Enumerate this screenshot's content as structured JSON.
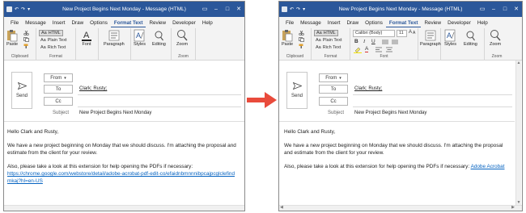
{
  "windows": {
    "left": {
      "title": "New Project Begins Next Monday  -  Message (HTML)",
      "menu": [
        "File",
        "Message",
        "Insert",
        "Draw",
        "Options",
        "Format Text",
        "Review",
        "Developer",
        "Help"
      ],
      "active_tab": "Format Text",
      "ribbon": {
        "paste": "Paste",
        "html": "HTML",
        "plain_text": "Plain Text",
        "rich_text": "Rich Text",
        "font": "Font",
        "paragraph": "Paragraph",
        "styles": "Styles",
        "editing": "Editing",
        "zoom": "Zoom",
        "group_clipboard": "Clipboard",
        "group_format": "Format",
        "group_zoom": "Zoom",
        "aa": "Aa"
      },
      "compose": {
        "send": "Send",
        "from": "From",
        "to": "To",
        "to_value": "Clark; Rusty;",
        "cc": "Cc",
        "subject_label": "Subject",
        "subject_value": "New Project Begins Next Monday"
      },
      "body": {
        "greeting": "Hello Clark and Rusty,",
        "para1": "We have a new project beginning on Monday that we should discuss. I'm attaching the proposal and estimate from the client for your review.",
        "para2": "Also, please take a look at this extension for help opening the PDFs if necessary:",
        "link": "https://chrome.google.com/webstore/detail/adobe-acrobat-pdf-edit-co/efaidnbmnnnibpcajpcglclefindmkaj?hl=en-US"
      }
    },
    "right": {
      "title": "New Project Begins Next Monday  -  Message (HTML)",
      "menu": [
        "File",
        "Message",
        "Insert",
        "Draw",
        "Options",
        "Format Text",
        "Review",
        "Developer",
        "Help"
      ],
      "active_tab": "Format Text",
      "ribbon": {
        "paste": "Paste",
        "html": "HTML",
        "plain_text": "Plain Text",
        "rich_text": "Rich Text",
        "font_name": "Calibri (Body)",
        "font_size": "11",
        "bold": "B",
        "italic": "I",
        "underline": "U",
        "paragraph": "Paragraph",
        "styles": "Styles",
        "editing": "Editing",
        "zoom": "Zoom",
        "group_clipboard": "Clipboard",
        "group_format": "Format",
        "group_font": "Font",
        "group_zoom": "Zoom",
        "aa": "Aa",
        "font_color_a": "A",
        "grow_a": "A",
        "shrink_a": "A"
      },
      "compose": {
        "send": "Send",
        "from": "From",
        "to": "To",
        "to_value": "Clark; Rusty;",
        "cc": "Cc",
        "subject_label": "Subject",
        "subject_value": "New Project Begins Next Monday"
      },
      "body": {
        "greeting": "Hello Clark and Rusty,",
        "para1": "We have a new project beginning on Monday that we should discuss. I'm attaching the proposal and estimate from the client for your review.",
        "para2_before": "Also, please take a look at this extension for help opening the PDFs if necessary: ",
        "link": "Adobe Acrobat"
      }
    }
  },
  "colors": {
    "titlebar": "#2b579a",
    "link": "#0563c1",
    "arrow": "#e94b3c"
  },
  "icons": [
    "save-icon",
    "undo-icon",
    "redo-icon",
    "paste-icon",
    "cut-icon",
    "copy-icon",
    "format-painter-icon",
    "font-icon",
    "paragraph-icon",
    "styles-icon",
    "editing-icon",
    "zoom-icon",
    "send-icon",
    "arrow-right-icon"
  ]
}
